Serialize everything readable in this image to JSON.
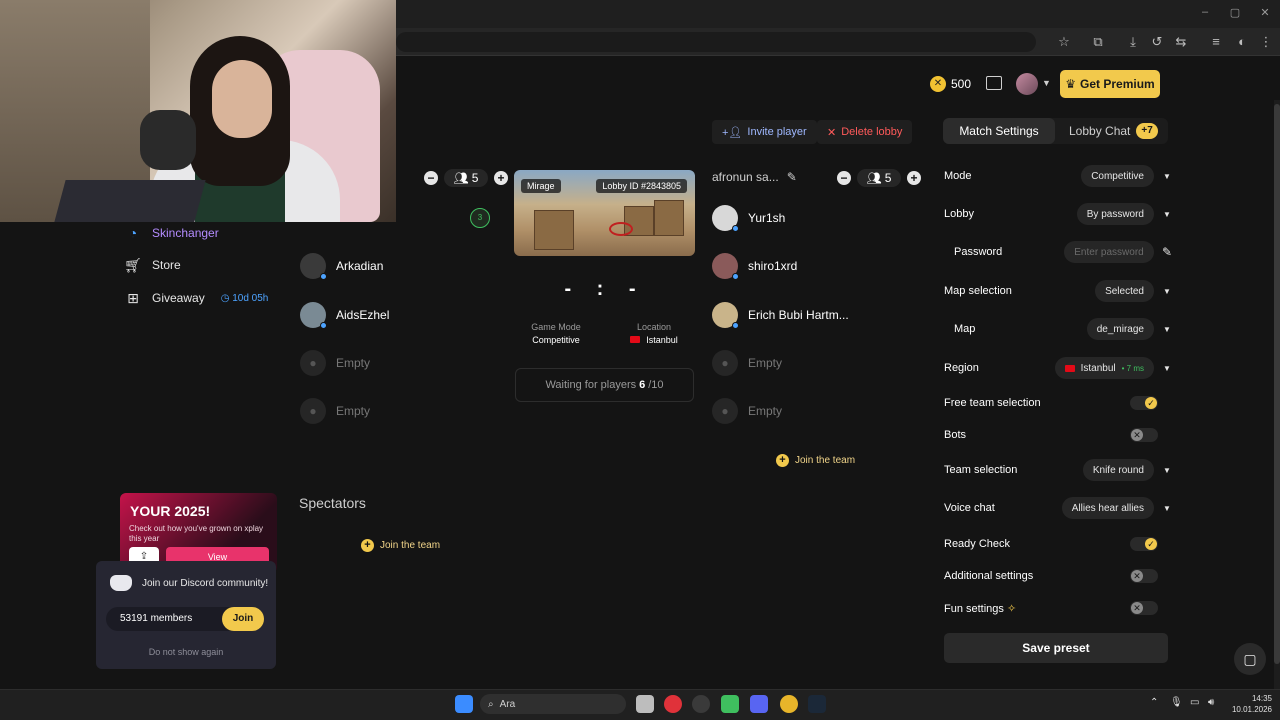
{
  "browser": {
    "window_controls": [
      "–",
      "▢",
      "✕"
    ]
  },
  "header": {
    "coins": "500",
    "premium_label": "Get Premium"
  },
  "sidebar": {
    "items": [
      {
        "label": "Skinchanger",
        "icon": "skinchanger-icon"
      },
      {
        "label": "Store",
        "icon": "cart-icon"
      },
      {
        "label": "Giveaway",
        "icon": "gift-icon",
        "timer": "10d 05h"
      }
    ]
  },
  "promo": {
    "title": "YOUR 2025!",
    "subtitle": "Check out how you've grown on xplay this year",
    "view_label": "View"
  },
  "discord": {
    "text": "Join our Discord community!",
    "members": "53191 members",
    "join_label": "Join",
    "dismiss": "Do not show again"
  },
  "lobby": {
    "invite_label": "Invite player",
    "delete_label": "Delete lobby",
    "team_left": {
      "count": "5",
      "players": [
        {
          "name": "Arkadian",
          "color": "#3a3a3a"
        },
        {
          "name": "AidsEzhel",
          "color": "#7a8a94"
        }
      ],
      "empty": [
        "Empty",
        "Empty"
      ]
    },
    "team_right": {
      "name": "afronun sa...",
      "count": "5",
      "players": [
        {
          "name": "Yur1sh",
          "color": "#d8d8d8"
        },
        {
          "name": "shiro1xrd",
          "color": "#8a5a5a"
        },
        {
          "name": "Erich Bubi Hartm...",
          "color": "#c9b48a"
        }
      ],
      "empty": [
        "Empty",
        "Empty"
      ],
      "join_label": "Join the team"
    },
    "map": {
      "name": "Mirage",
      "lobby_id": "Lobby ID #2843805"
    },
    "score": "- : -",
    "game_mode_label": "Game Mode",
    "game_mode_value": "Competitive",
    "location_label": "Location",
    "location_value": "Istanbul",
    "waiting_prefix": "Waiting for players",
    "waiting_count": "6",
    "waiting_total": "/10",
    "spectators_label": "Spectators",
    "spectators_join": "Join the team",
    "badge_count": "3"
  },
  "settings": {
    "tab_match": "Match Settings",
    "tab_chat": "Lobby Chat",
    "chat_badge": "+7",
    "rows": {
      "mode": {
        "label": "Mode",
        "value": "Competitive"
      },
      "lobby": {
        "label": "Lobby",
        "value": "By password"
      },
      "password": {
        "label": "Password",
        "placeholder": "Enter password"
      },
      "map_selection": {
        "label": "Map selection",
        "value": "Selected"
      },
      "map": {
        "label": "Map",
        "value": "de_mirage"
      },
      "region": {
        "label": "Region",
        "value": "Istanbul",
        "ping": "• 7 ms"
      },
      "free_team": {
        "label": "Free team selection",
        "on": true
      },
      "bots": {
        "label": "Bots",
        "on": false
      },
      "team_selection": {
        "label": "Team selection",
        "value": "Knife round"
      },
      "voice_chat": {
        "label": "Voice chat",
        "value": "Allies hear allies"
      },
      "ready_check": {
        "label": "Ready Check",
        "on": true
      },
      "additional": {
        "label": "Additional settings",
        "on": false
      },
      "fun": {
        "label": "Fun settings",
        "on": false
      }
    },
    "save_preset": "Save preset"
  },
  "taskbar": {
    "search_placeholder": "Ara",
    "time": "14:35",
    "date": "10.01.2026"
  }
}
